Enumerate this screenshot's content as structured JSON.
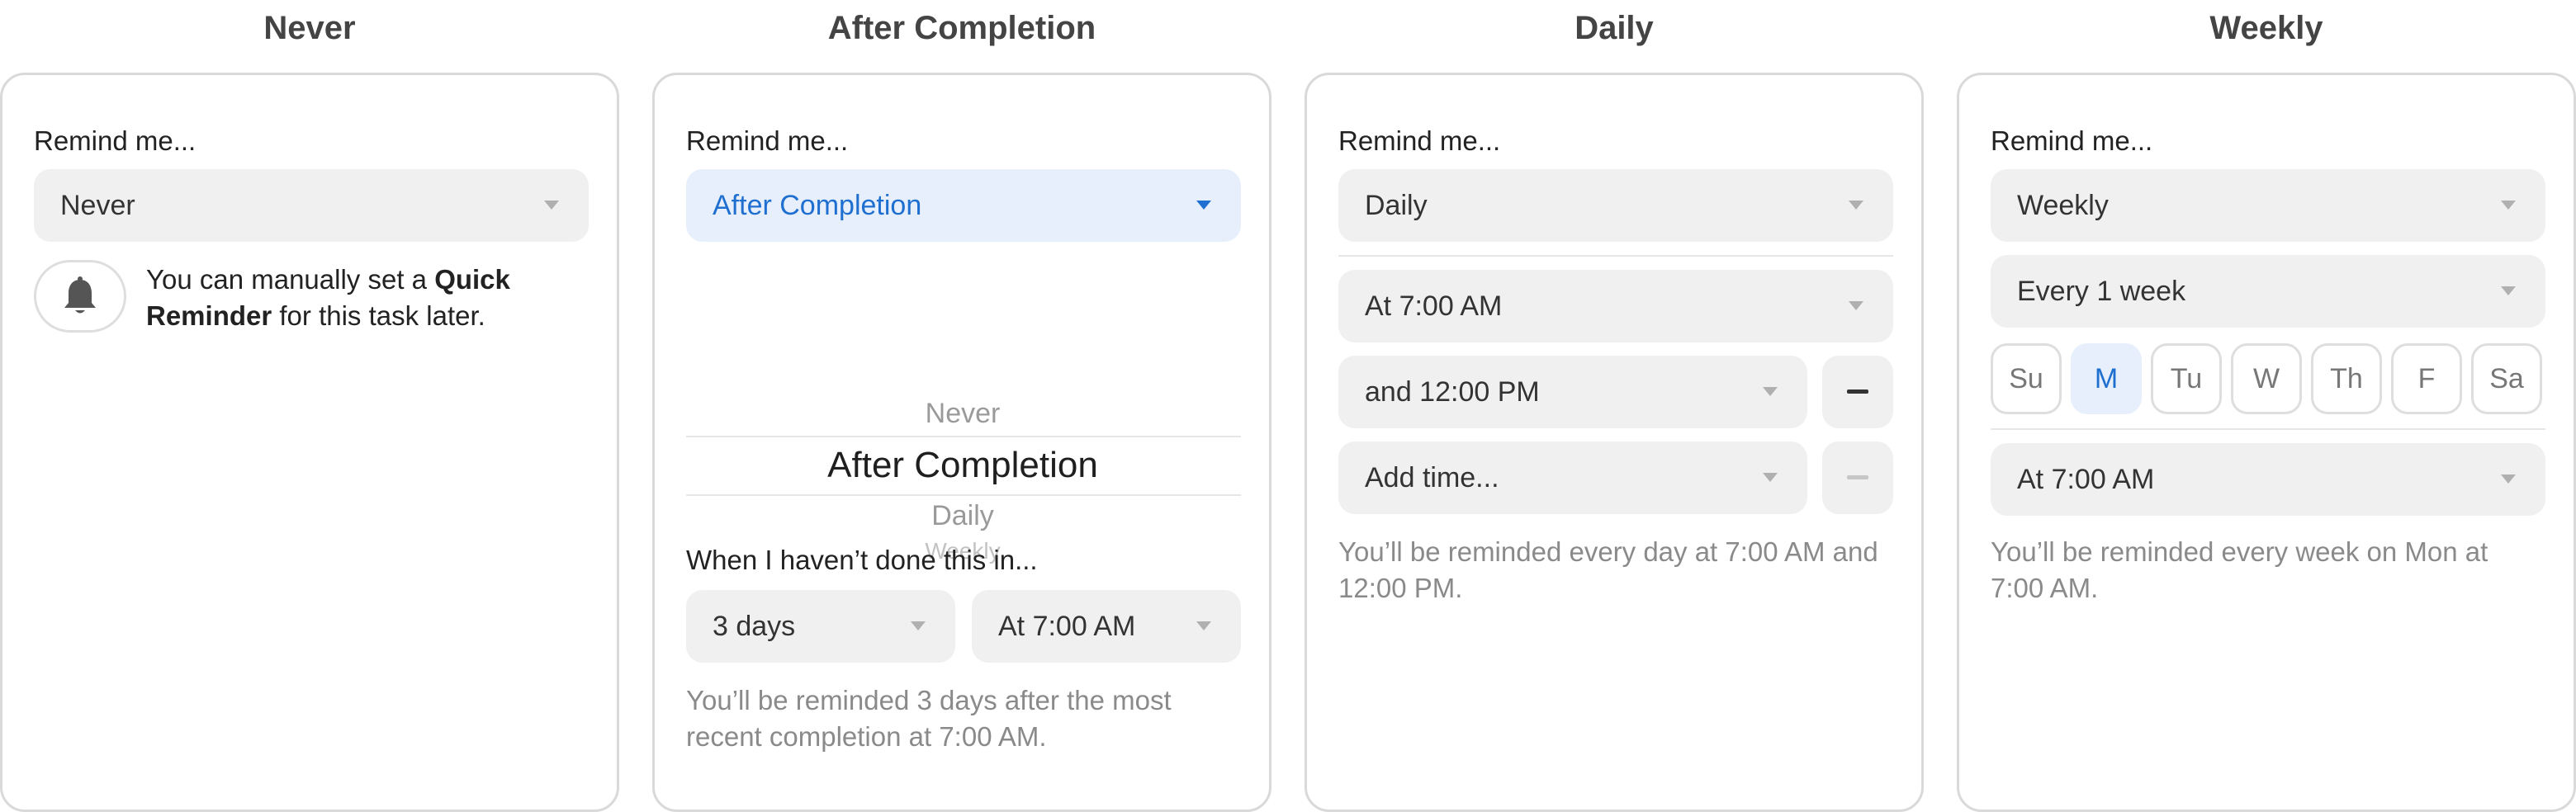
{
  "panels": {
    "never": {
      "title": "Never",
      "remind_label": "Remind me...",
      "select_value": "Never",
      "hint_pre": "You can manually set a ",
      "hint_bold1": "Quick",
      "hint_bold2": "Reminder",
      "hint_post": " for this task later.",
      "icon": "bell-icon"
    },
    "after_completion": {
      "title": "After Completion",
      "remind_label": "Remind me...",
      "select_value": "After Completion",
      "wheel": [
        "Never",
        "After Completion",
        "Daily",
        "Weekly"
      ],
      "when_label": "When I haven’t done this in...",
      "days_value": "3 days",
      "time_value": "At 7:00 AM",
      "note": "You’ll be reminded 3 days after the most recent completion at 7:00 AM."
    },
    "daily": {
      "title": "Daily",
      "remind_label": "Remind me...",
      "select_value": "Daily",
      "time1": "At 7:00 AM",
      "time2": "and 12:00 PM",
      "add_time": "Add time...",
      "note": "You’ll be reminded every day at 7:00 AM and 12:00 PM."
    },
    "weekly": {
      "title": "Weekly",
      "remind_label": "Remind me...",
      "select_value": "Weekly",
      "interval": "Every 1 week",
      "days": [
        "Su",
        "M",
        "Tu",
        "W",
        "Th",
        "F",
        "Sa"
      ],
      "selected_day": "M",
      "time": "At 7:00 AM",
      "note": "You’ll be reminded every week on Mon at 7:00 AM."
    }
  },
  "colors": {
    "accent": "#1f6fd1",
    "accent_bg": "#e6effb",
    "field_bg": "#f0f0f0",
    "border": "#d9d9d9",
    "muted_text": "#8a8a8a"
  }
}
